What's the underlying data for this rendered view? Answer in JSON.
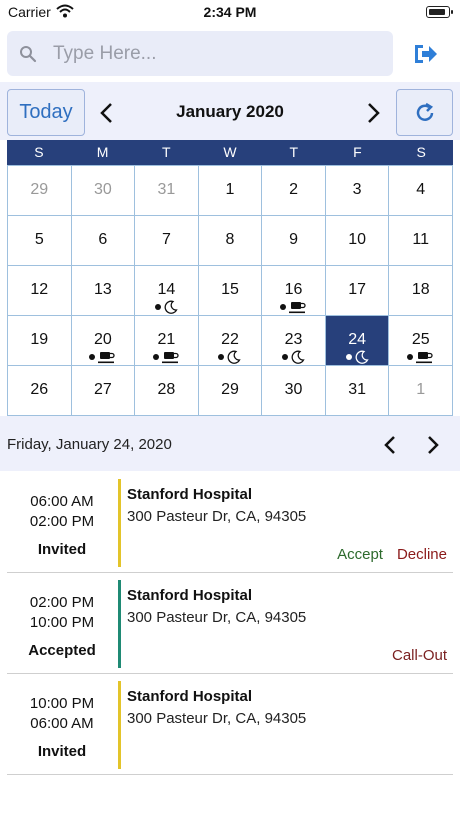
{
  "status_bar": {
    "carrier": "Carrier",
    "time": "2:34 PM"
  },
  "search": {
    "placeholder": "Type Here...",
    "value": ""
  },
  "icons": {
    "search": "search-icon",
    "logout": "logout-icon",
    "refresh": "refresh-icon",
    "night": "moon-icon",
    "day": "coffee-cup-icon"
  },
  "colors": {
    "accent": "#2f6fc0",
    "header_navy": "#27407b",
    "invited_bar": "#e3c42a",
    "accepted_bar": "#1f8a74",
    "accept": "#2d6a2d",
    "decline": "#8b1a1a"
  },
  "calendar": {
    "today_label": "Today",
    "month_title": "January 2020",
    "weekdays": [
      "S",
      "M",
      "T",
      "W",
      "T",
      "F",
      "S"
    ],
    "weeks": [
      [
        "29",
        "30",
        "31",
        "1",
        "2",
        "3",
        "4"
      ],
      [
        "5",
        "6",
        "7",
        "8",
        "9",
        "10",
        "11"
      ],
      [
        "12",
        "13",
        "14",
        "15",
        "16",
        "17",
        "18"
      ],
      [
        "19",
        "20",
        "21",
        "22",
        "23",
        "24",
        "25"
      ],
      [
        "26",
        "27",
        "28",
        "29",
        "30",
        "31",
        "1"
      ]
    ],
    "selected_day": "24",
    "shift_markers": {
      "14": "moon",
      "16": "coffee",
      "20": "coffee",
      "21": "coffee",
      "22": "moon",
      "23": "moon",
      "24": "moon",
      "25": "coffee"
    }
  },
  "day_view": {
    "date_label": "Friday, January 24, 2020"
  },
  "shifts": [
    {
      "start": "06:00 AM",
      "end": "02:00 PM",
      "status": "Invited",
      "hospital": "Stanford Hospital",
      "address": "300 Pasteur Dr, CA, 94305",
      "actions": [
        "Accept",
        "Decline"
      ]
    },
    {
      "start": "02:00 PM",
      "end": "10:00 PM",
      "status": "Accepted",
      "hospital": "Stanford Hospital",
      "address": "300 Pasteur Dr, CA, 94305",
      "actions": [
        "Call-Out"
      ]
    },
    {
      "start": "10:00 PM",
      "end": "06:00 AM",
      "status": "Invited",
      "hospital": "Stanford Hospital",
      "address": "300 Pasteur Dr, CA, 94305",
      "actions": []
    }
  ]
}
